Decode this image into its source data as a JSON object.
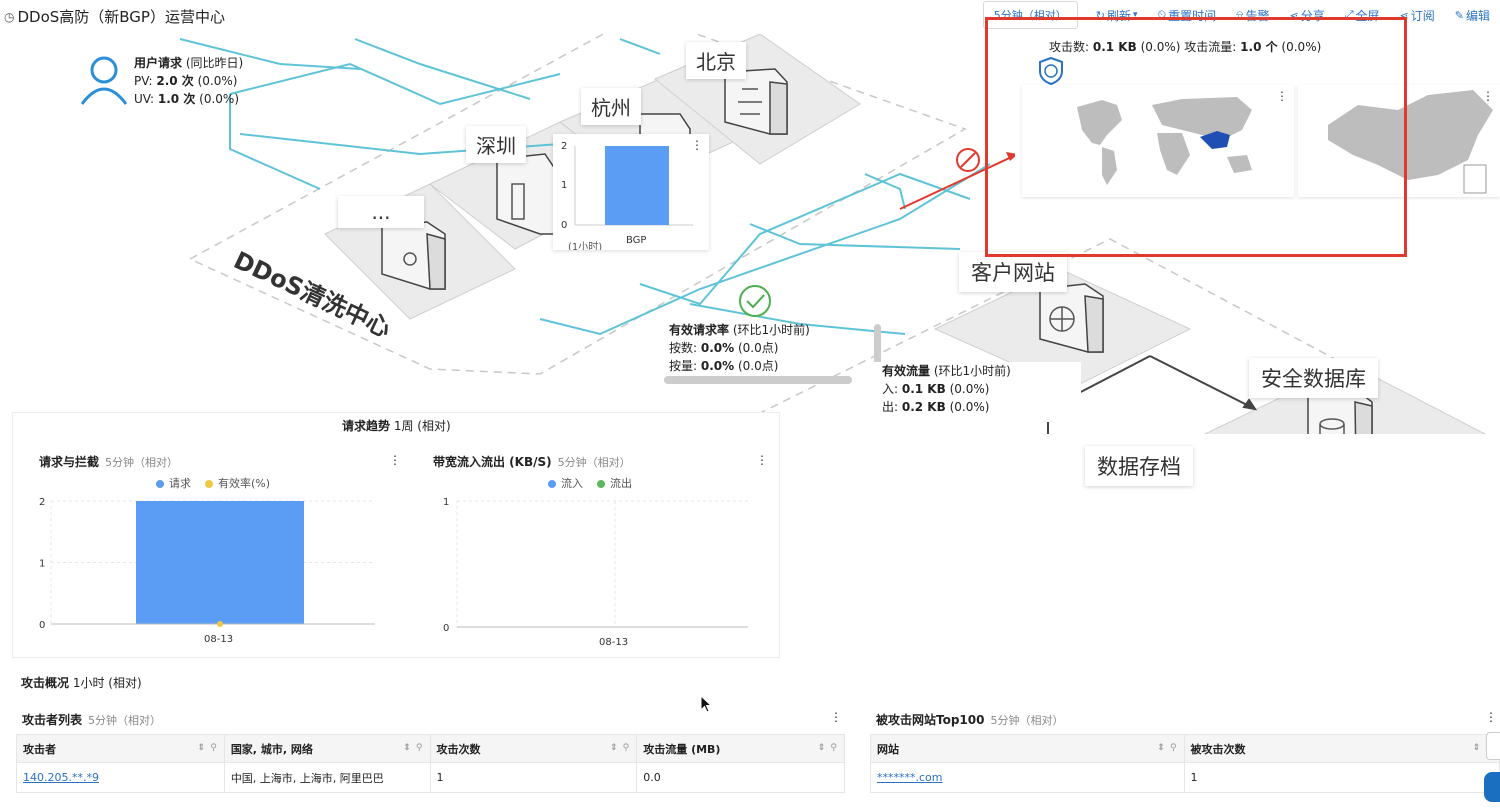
{
  "header": {
    "title": "DDoS高防（新BGP）运营中心",
    "time_select": "5分钟（相对）",
    "buttons": [
      {
        "label": "刷新",
        "icon": "refresh-icon",
        "glyph": "↻"
      },
      {
        "label": "重置时间",
        "icon": "reset-time-icon",
        "glyph": "⏲"
      },
      {
        "label": "告警",
        "icon": "bell-icon",
        "glyph": "⍾"
      },
      {
        "label": "分享",
        "icon": "share-icon",
        "glyph": "⋖"
      },
      {
        "label": "全屏",
        "icon": "fullscreen-icon",
        "glyph": "⤢"
      },
      {
        "label": "订阅",
        "icon": "subscribe-icon",
        "glyph": "⋖"
      },
      {
        "label": "编辑",
        "icon": "edit-icon",
        "glyph": "✎"
      }
    ]
  },
  "topology": {
    "user_stats": {
      "title": "用户请求",
      "title_note": "(同比昨日)",
      "pv_label": "PV:",
      "pv_value": "2.0 次",
      "pv_change": "(0.0%)",
      "uv_label": "UV:",
      "uv_value": "1.0 次",
      "uv_change": "(0.0%)"
    },
    "cities": [
      "北京",
      "杭州",
      "深圳",
      "..."
    ],
    "cleaning_center": "DDoS清洗中心",
    "mini_chart": {
      "category": "BGP",
      "value": 2,
      "y_ticks": [
        "2",
        "1",
        "0"
      ],
      "x_note": "(1小时)"
    },
    "valid_request_rate": {
      "title": "有效请求率",
      "note": "(环比1小时前)",
      "by_count_label": "按数:",
      "by_count_value": "0.0%",
      "by_count_change": "(0.0点)",
      "by_volume_label": "按量:",
      "by_volume_value": "0.0%",
      "by_volume_change": "(0.0点)"
    },
    "valid_traffic": {
      "title": "有效流量",
      "note": "(环比1小时前)",
      "in_label": "入:",
      "in_value": "0.1 KB",
      "in_change": "(0.0%)",
      "out_label": "出:",
      "out_value": "0.2 KB",
      "out_change": "(0.0%)"
    },
    "customer_site": "客户网站",
    "security_db": "安全数据库",
    "data_archive": "数据存档"
  },
  "attack_panel": {
    "count_label": "攻击数:",
    "count_value": "0.1 KB",
    "count_change": "(0.0%)",
    "traffic_label": "攻击流量:",
    "traffic_value": "1.0 个",
    "traffic_change": "(0.0%)",
    "highlight_color": "#e03a2e"
  },
  "trend": {
    "title": "请求趋势",
    "range": "1周 (相对)",
    "charts": [
      {
        "title": "请求与拦截",
        "range": "5分钟（相对）",
        "legend": [
          {
            "name": "请求",
            "color": "#5b9cf5"
          },
          {
            "name": "有效率(%)",
            "color": "#f2c744"
          }
        ]
      },
      {
        "title": "带宽流入流出 (KB/S)",
        "range": "5分钟（相对）",
        "legend": [
          {
            "name": "流入",
            "color": "#5b9cf5"
          },
          {
            "name": "流出",
            "color": "#5cb85c"
          }
        ]
      }
    ]
  },
  "chart_data": [
    {
      "type": "bar",
      "categories": [
        "08-13"
      ],
      "series": [
        {
          "name": "请求",
          "values": [
            2
          ]
        },
        {
          "name": "有效率(%)",
          "values": [
            0
          ]
        }
      ],
      "title": "请求与拦截",
      "ylim": [
        0,
        2
      ],
      "y_ticks": [
        "2",
        "1",
        "0"
      ],
      "y2lim": [
        0,
        1
      ],
      "y2_ticks": [
        "1",
        "0"
      ],
      "grid": true
    },
    {
      "type": "line",
      "categories": [
        "08-13"
      ],
      "series": [
        {
          "name": "流入",
          "values": []
        },
        {
          "name": "流出",
          "values": []
        }
      ],
      "title": "带宽流入流出 (KB/S)",
      "ylim": [
        0,
        1
      ],
      "y_ticks": [
        "1",
        "0"
      ],
      "grid": true
    }
  ],
  "attack_overview": {
    "title": "攻击概况",
    "range": "1小时 (相对)",
    "attackers_table": {
      "title": "攻击者列表",
      "range": "5分钟（相对）",
      "columns": [
        "攻击者",
        "国家, 城市, 网络",
        "攻击次数",
        "攻击流量 (MB)"
      ],
      "rows": [
        [
          "140.205.**.*9",
          "中国, 上海市, 上海市, 阿里巴巴",
          "1",
          "0.0"
        ]
      ]
    },
    "sites_table": {
      "title": "被攻击网站Top100",
      "range": "5分钟（相对）",
      "columns": [
        "网站",
        "被攻击次数"
      ],
      "rows": [
        [
          "*******.com",
          "1"
        ]
      ]
    }
  }
}
